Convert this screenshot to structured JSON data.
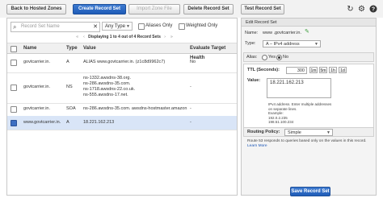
{
  "toolbar": {
    "back_label": "Back to Hosted Zones",
    "create_label": "Create Record Set",
    "import_label": "Import Zone File",
    "delete_label": "Delete Record Set",
    "test_label": "Test Record Set",
    "refresh_icon": "refresh-icon",
    "settings_icon": "gear-icon",
    "help_icon": "help-icon"
  },
  "filter": {
    "search_placeholder": "Record Set Name",
    "type_selected": "Any Type",
    "aliases_only_label": "Aliases Only",
    "weighted_only_label": "Weighted Only"
  },
  "pager": {
    "text": "Displaying 1 to 4 out of 4 Record Sets"
  },
  "table": {
    "headers": [
      "Name",
      "Type",
      "Value",
      "Evaluate Target Health"
    ],
    "rows": [
      {
        "name": "govtcarrier.in.",
        "type": "A",
        "value": "ALIAS www.govtcarrier.in. (z1c8d9962c7)",
        "health": "No",
        "selected": false
      },
      {
        "name": "govtcarrier.in.",
        "type": "NS",
        "value": "ns-1332.awsdns-38.org.\nns-286.awsdns-35.com.\nns-1718.awsdns-22.co.uk.\nns-555.awsdns-17.net.",
        "health": "-",
        "selected": false
      },
      {
        "name": "govtcarrier.in.",
        "type": "SOA",
        "value": "ns-286.awsdns-35.com. awsdns-hostmaster.amazon",
        "health": "-",
        "selected": false
      },
      {
        "name": "www.govtcarrier.in.",
        "type": "A",
        "value": "18.221.162.213",
        "health": "-",
        "selected": true
      }
    ]
  },
  "editor": {
    "title": "Edit Record Set",
    "name_label": "Name:",
    "name_value": "www .govtcarrier.in.",
    "type_label": "Type:",
    "type_value": "A – IPv4 address",
    "alias_label": "Alias:",
    "alias_yes": "Yes",
    "alias_no": "No",
    "ttl_label": "TTL (Seconds):",
    "ttl_value": "300",
    "ttl_buttons": [
      "1m",
      "5m",
      "1h",
      "1d"
    ],
    "value_label": "Value:",
    "value_text": "18.221.162.213",
    "value_hint": "IPv4 address. Enter multiple addresses\non separate lines.\nExample:\n  192.0.2.235\n  198.51.100.234",
    "routing_label": "Routing Policy:",
    "routing_value": "Simple",
    "routing_desc": "Route 53 responds to queries based only on the values in this record.",
    "learn_more": "Learn More",
    "save_label": "Save Record Set"
  }
}
